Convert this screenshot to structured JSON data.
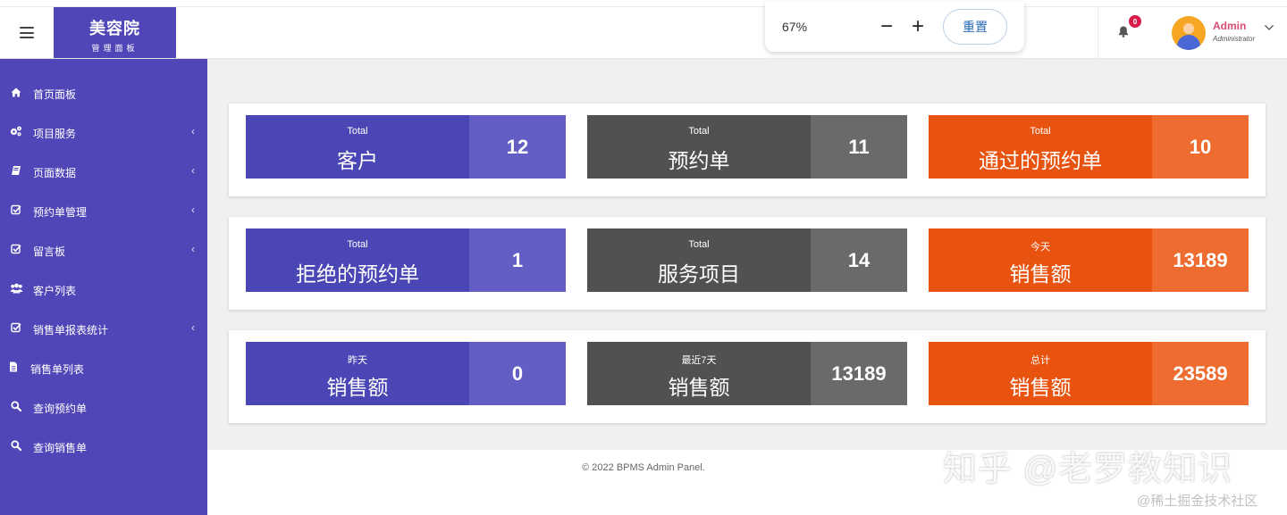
{
  "header": {
    "brand_title": "美容院",
    "brand_subtitle": "管理面板",
    "zoom_value": "67%",
    "zoom_minus": "−",
    "zoom_plus": "+",
    "zoom_reset": "重置",
    "notification_count": "0",
    "user_name": "Admin",
    "user_role": "Administrator"
  },
  "sidebar": {
    "items": [
      {
        "label": "首页面板",
        "icon": "home-icon",
        "has_submenu": false
      },
      {
        "label": "项目服务",
        "icon": "cogs-icon",
        "has_submenu": true
      },
      {
        "label": "页面数据",
        "icon": "book-icon",
        "has_submenu": true
      },
      {
        "label": "预约单管理",
        "icon": "checkbox-icon",
        "has_submenu": true
      },
      {
        "label": "留言板",
        "icon": "checkbox-icon",
        "has_submenu": true
      },
      {
        "label": "客户列表",
        "icon": "users-icon",
        "has_submenu": false
      },
      {
        "label": "销售单报表统计",
        "icon": "checkbox-icon",
        "has_submenu": true
      },
      {
        "label": "销售单列表",
        "icon": "file-icon",
        "has_submenu": false
      },
      {
        "label": "查询预约单",
        "icon": "search-icon",
        "has_submenu": false
      },
      {
        "label": "查询销售单",
        "icon": "search-icon",
        "has_submenu": false
      }
    ]
  },
  "dashboard": {
    "rows": [
      [
        {
          "sub": "Total",
          "title": "客户",
          "value": "12",
          "color": "blue"
        },
        {
          "sub": "Total",
          "title": "预约单",
          "value": "11",
          "color": "gray"
        },
        {
          "sub": "Total",
          "title": "通过的预约单",
          "value": "10",
          "color": "orange"
        }
      ],
      [
        {
          "sub": "Total",
          "title": "拒绝的预约单",
          "value": "1",
          "color": "blue"
        },
        {
          "sub": "Total",
          "title": "服务项目",
          "value": "14",
          "color": "gray"
        },
        {
          "sub": "今天",
          "title": "销售额",
          "value": "13189",
          "color": "orange"
        }
      ],
      [
        {
          "sub": "昨天",
          "title": "销售额",
          "value": "0",
          "color": "blue"
        },
        {
          "sub": "最近7天",
          "title": "销售额",
          "value": "13189",
          "color": "gray"
        },
        {
          "sub": "总计",
          "title": "销售额",
          "value": "23589",
          "color": "orange"
        }
      ]
    ]
  },
  "colors": {
    "sidebar": "#5046b8",
    "blue_main": "#4b46b6",
    "blue_num": "#625ec3",
    "gray_main": "#515151",
    "gray_num": "#6a6a6a",
    "orange_main": "#e8530f",
    "orange_num": "#ee6c2f"
  },
  "footer": {
    "copyright": "© 2022 BPMS Admin Panel."
  },
  "watermark": {
    "main": "知乎 @老罗教知识",
    "corner": "@稀土掘金技术社区"
  }
}
